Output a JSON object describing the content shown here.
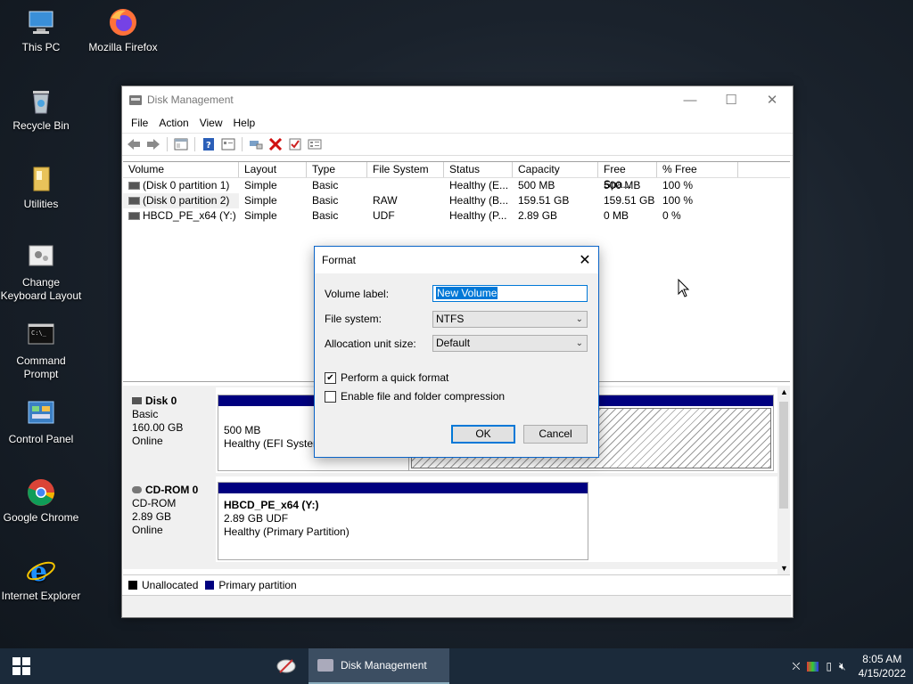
{
  "desktop": {
    "icons": [
      {
        "label": "This PC"
      },
      {
        "label": "Mozilla Firefox"
      },
      {
        "label": "Recycle Bin"
      },
      {
        "label": "Utilities"
      },
      {
        "label_line1": "Change",
        "label_line2": "Keyboard Layout"
      },
      {
        "label_line1": "Command",
        "label_line2": "Prompt"
      },
      {
        "label": "Control Panel"
      },
      {
        "label": "Google Chrome"
      },
      {
        "label": "Internet Explorer"
      }
    ]
  },
  "window": {
    "title": "Disk Management",
    "controls": {
      "minimize": "—",
      "maximize": "☐",
      "close": "✕"
    },
    "menu": [
      "File",
      "Action",
      "View",
      "Help"
    ],
    "table": {
      "headers": [
        "Volume",
        "Layout",
        "Type",
        "File System",
        "Status",
        "Capacity",
        "Free Spa...",
        "% Free"
      ],
      "rows": [
        [
          "(Disk 0 partition 1)",
          "Simple",
          "Basic",
          "",
          "Healthy (E...",
          "500 MB",
          "500 MB",
          "100 %"
        ],
        [
          "(Disk 0 partition 2)",
          "Simple",
          "Basic",
          "RAW",
          "Healthy (B...",
          "159.51 GB",
          "159.51 GB",
          "100 %"
        ],
        [
          "HBCD_PE_x64 (Y:)",
          "Simple",
          "Basic",
          "UDF",
          "Healthy (P...",
          "2.89 GB",
          "0 MB",
          "0 %"
        ]
      ]
    },
    "disks": [
      {
        "name": "Disk 0",
        "type": "Basic",
        "size": "160.00 GB",
        "status": "Online",
        "part1_size": "500 MB",
        "part1_status": "Healthy (EFI System"
      },
      {
        "name": "CD-ROM 0",
        "type": "CD-ROM",
        "size": "2.89 GB",
        "status": "Online",
        "part_name": "HBCD_PE_x64  (Y:)",
        "part_size": "2.89 GB UDF",
        "part_status": "Healthy (Primary Partition)"
      }
    ],
    "legend": {
      "unallocated": "Unallocated",
      "primary": "Primary partition",
      "unallocated_color": "#000000",
      "primary_color": "#00007f"
    }
  },
  "dialog": {
    "title": "Format",
    "volume_label_caption": "Volume label:",
    "volume_label_value": "New Volume",
    "file_system_caption": "File system:",
    "file_system_value": "NTFS",
    "alloc_caption": "Allocation unit size:",
    "alloc_value": "Default",
    "quick_format_label": "Perform a quick format",
    "quick_format_checked": true,
    "compression_label": "Enable file and folder compression",
    "compression_checked": false,
    "ok_label": "OK",
    "cancel_label": "Cancel"
  },
  "taskbar": {
    "active_app": "Disk Management",
    "time": "8:05 AM",
    "date": "4/15/2022"
  }
}
